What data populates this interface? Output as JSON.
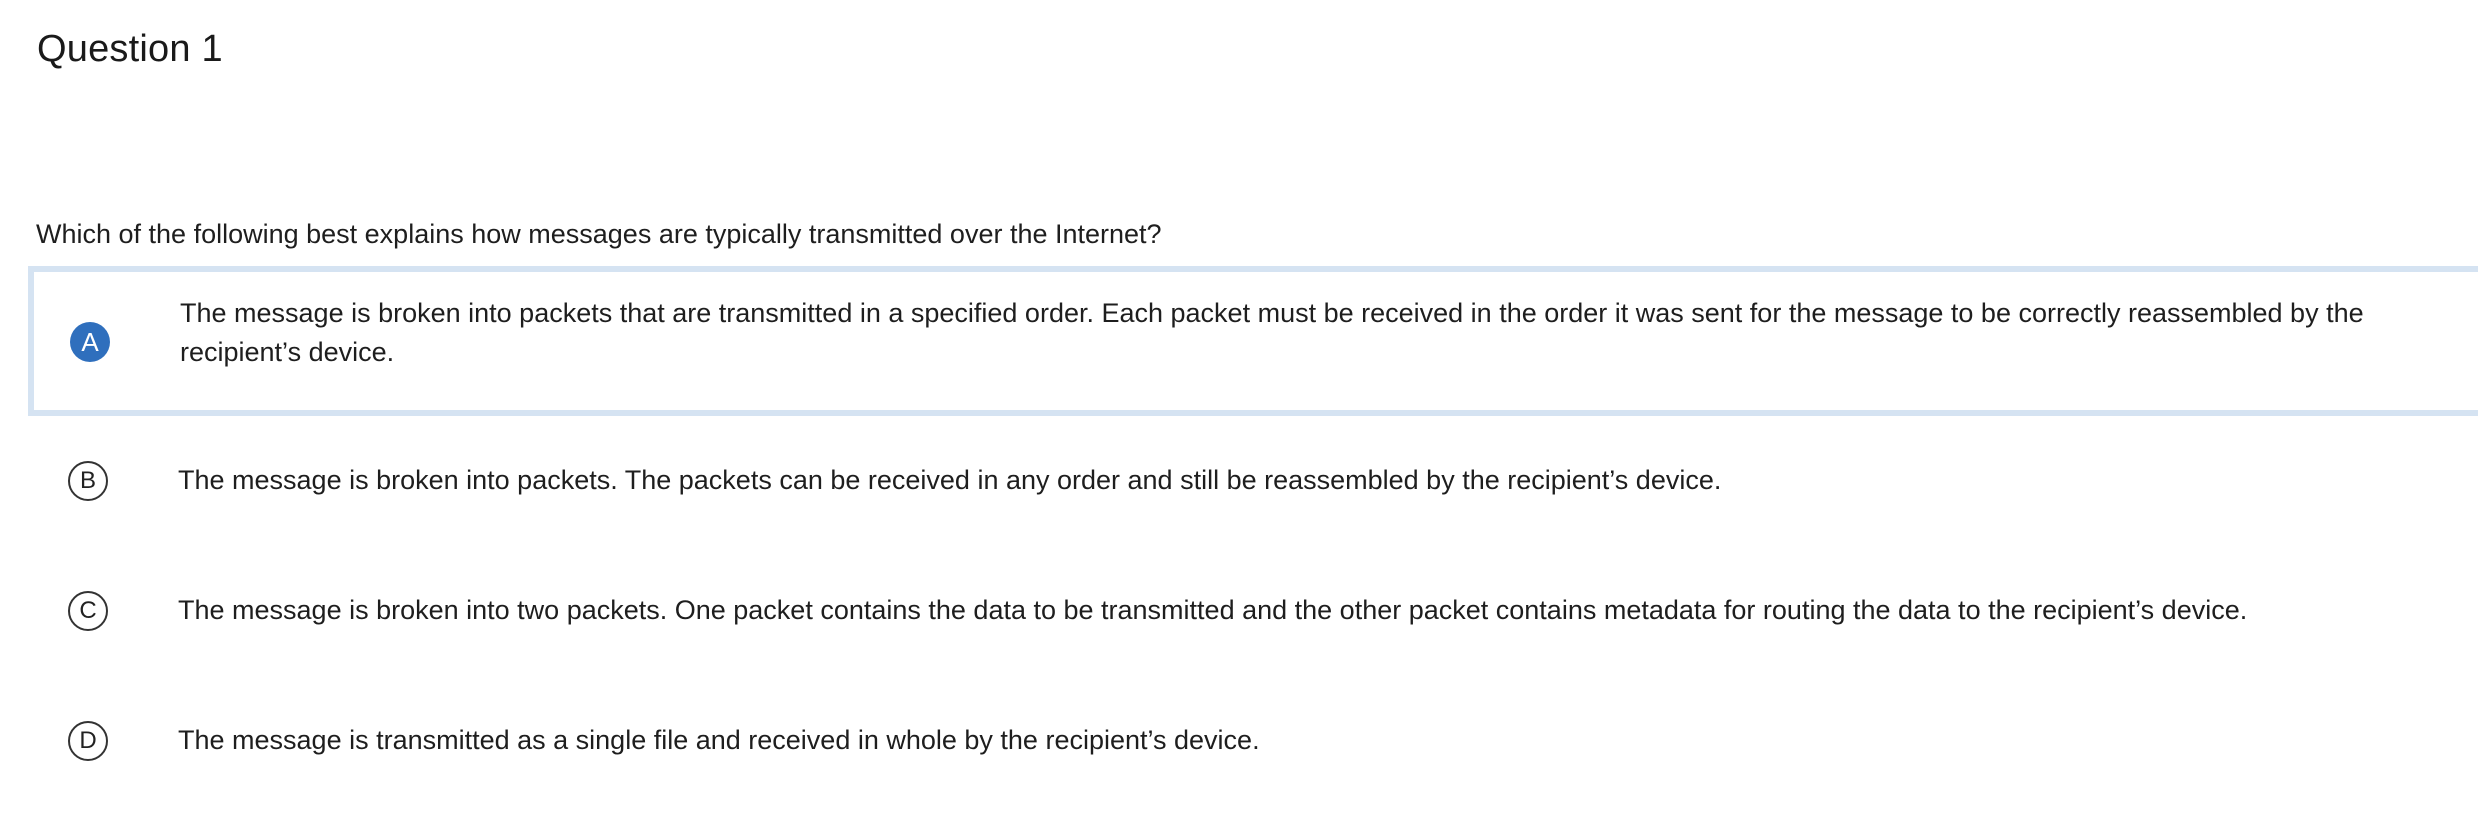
{
  "question": {
    "title": "Question 1",
    "stem": "Which of the following best explains how messages are typically transmitted over the Internet?"
  },
  "choices": [
    {
      "letter": "A",
      "text": "The message is broken into packets that are transmitted in a specified order. Each packet must be received in the order it was sent for the message to be correctly reassembled by the recipient’s device.",
      "selected": true
    },
    {
      "letter": "B",
      "text": "The message is broken into packets. The packets can be received in any order and still be reassembled by the recipient’s device.",
      "selected": false
    },
    {
      "letter": "C",
      "text": "The message is broken into two packets. One packet contains the data to be transmitted and the other packet contains metadata for routing the data to the recipient’s device.",
      "selected": false
    },
    {
      "letter": "D",
      "text": "The message is transmitted as a single file and received in whole by the recipient’s device.",
      "selected": false
    }
  ],
  "colors": {
    "selected_marker": "#2f6fbd",
    "selected_border": "#d5e3f2",
    "text": "#1e1e1e"
  }
}
